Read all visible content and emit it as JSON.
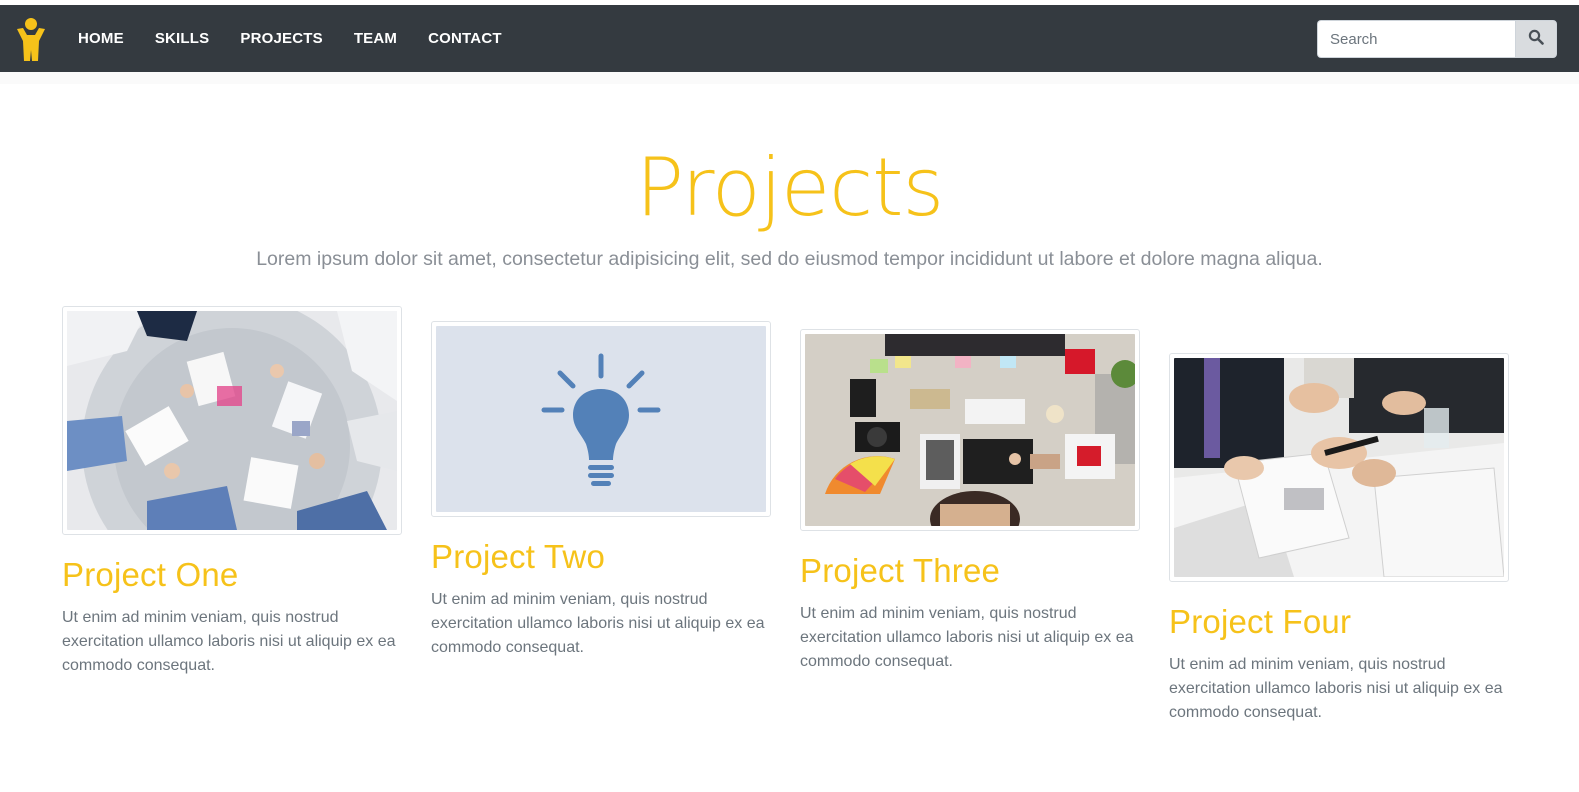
{
  "nav": {
    "links": [
      "HOME",
      "SKILLS",
      "PROJECTS",
      "TEAM",
      "CONTACT"
    ],
    "search_placeholder": "Search",
    "logo_icon": "person-arms-up-icon",
    "search_icon": "search-icon"
  },
  "section": {
    "title": "Projects",
    "subtitle": "Lorem ipsum dolor sit amet, consectetur adipisicing elit, sed do eiusmod tempor incididunt ut labore et dolore magna aliqua."
  },
  "projects": [
    {
      "title": "Project One",
      "text": "Ut enim ad minim veniam, quis nostrud exercitation ullamco laboris nisi ut aliquip ex ea commodo consequat.",
      "image": "team-meeting-round-table-photo"
    },
    {
      "title": "Project Two",
      "text": "Ut enim ad minim veniam, quis nostrud exercitation ullamco laboris nisi ut aliquip ex ea commodo consequat.",
      "image": "lightbulb-icon"
    },
    {
      "title": "Project Three",
      "text": "Ut enim ad minim veniam, quis nostrud exercitation ullamco laboris nisi ut aliquip ex ea commodo consequat.",
      "image": "designer-desk-photo"
    },
    {
      "title": "Project Four",
      "text": "Ut enim ad minim veniam, quis nostrud exercitation ullamco laboris nisi ut aliquip ex ea commodo consequat.",
      "image": "business-handshake-documents-photo"
    }
  ],
  "colors": {
    "accent": "#f6c21a",
    "navbar": "#343a40",
    "muted_text": "#6c757d",
    "bulb_blue": "#5381b8",
    "bulb_bg": "#dce2ec"
  }
}
